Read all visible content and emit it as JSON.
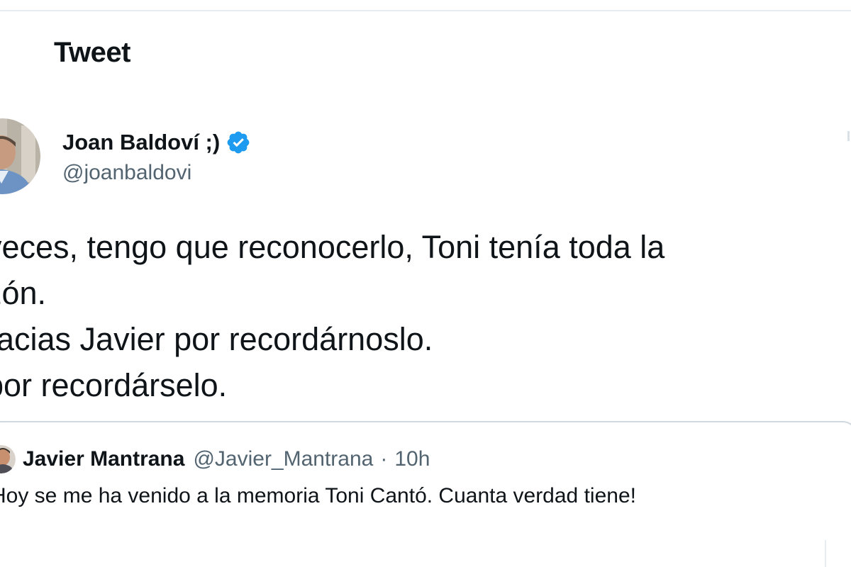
{
  "header": {
    "title": "Tweet"
  },
  "author": {
    "name": "Joan Baldoví ;)",
    "handle": "@joanbaldovi",
    "avatar_icon": "avatar-photo-icon",
    "verified_icon": "verified-badge-icon",
    "verified_color": "#1d9bf0"
  },
  "tweet": {
    "lines": [
      "veces, tengo que reconocerlo, Toni tenía toda la",
      "zón.",
      "racias Javier por recordárnoslo.",
      "por recordárselo."
    ]
  },
  "quoted_tweet": {
    "author_name": "Javier Mantrana",
    "author_handle": "@Javier_Mantrana",
    "separator": "·",
    "time": "10h",
    "text": "Hoy se me ha venido a la memoria Toni Cantó. Cuanta verdad tiene!",
    "avatar_icon": "avatar-photo-icon"
  },
  "colors": {
    "text_primary": "#0f1419",
    "text_secondary": "#536471",
    "border": "#cfd9de",
    "accent": "#1d9bf0"
  }
}
